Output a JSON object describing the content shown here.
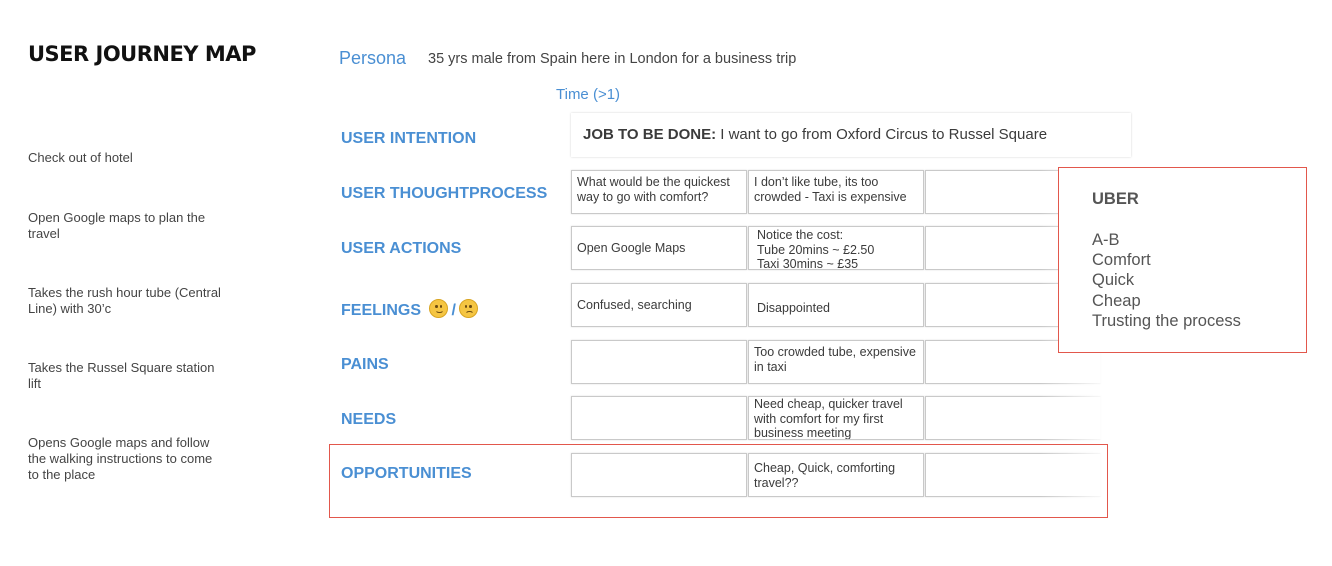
{
  "title": "USER JOURNEY MAP",
  "steps": [
    "Check out of hotel",
    "Open Google maps to plan the travel",
    "Takes the rush hour tube (Central Line) with 30’c",
    "Takes the Russel Square station lift",
    "Opens Google maps and follow the walking instructions to come to the place"
  ],
  "persona": {
    "label": "Persona",
    "text": "35 yrs male from Spain here in London for a business trip"
  },
  "time_label": "Time (>1)",
  "job_to_be_done": {
    "prefix": "JOB TO BE DONE:",
    "text": "I want to go from Oxford Circus to Russel Square"
  },
  "rows": {
    "intention": {
      "label": "USER INTENTION"
    },
    "thoughtprocess": {
      "label": "USER THOUGHTPROCESS",
      "cells": [
        "What would be the quickest way to go with comfort?",
        "I don’t like tube, its too crowded - Taxi is expensive",
        ""
      ]
    },
    "actions": {
      "label": "USER ACTIONS",
      "cells": [
        "Open Google Maps",
        "Notice the cost:\nTube 20mins ~ £2.50\nTaxi 30mins ~ £35",
        ""
      ]
    },
    "feelings": {
      "label": "FEELINGS",
      "separator": "/",
      "emojis": [
        "slightly-smiling-face-icon",
        "worried-face-icon"
      ],
      "cells": [
        "Confused, searching",
        "Disappointed",
        ""
      ]
    },
    "pains": {
      "label": "PAINS",
      "cells": [
        "",
        "Too crowded tube, expensive in taxi",
        ""
      ]
    },
    "needs": {
      "label": "NEEDS",
      "cells": [
        "",
        "Need cheap, quicker travel with comfort for my first business meeting",
        ""
      ]
    },
    "opportunities": {
      "label": "OPPORTUNITIES",
      "cells": [
        "",
        "Cheap, Quick, comforting travel??",
        ""
      ]
    }
  },
  "uber": {
    "title": "UBER",
    "items": [
      "A-B",
      "Comfort",
      "Quick",
      "Cheap",
      "Trusting the process"
    ]
  },
  "colors": {
    "accent_blue": "#4a8fd3",
    "highlight_red": "#e2574c"
  }
}
